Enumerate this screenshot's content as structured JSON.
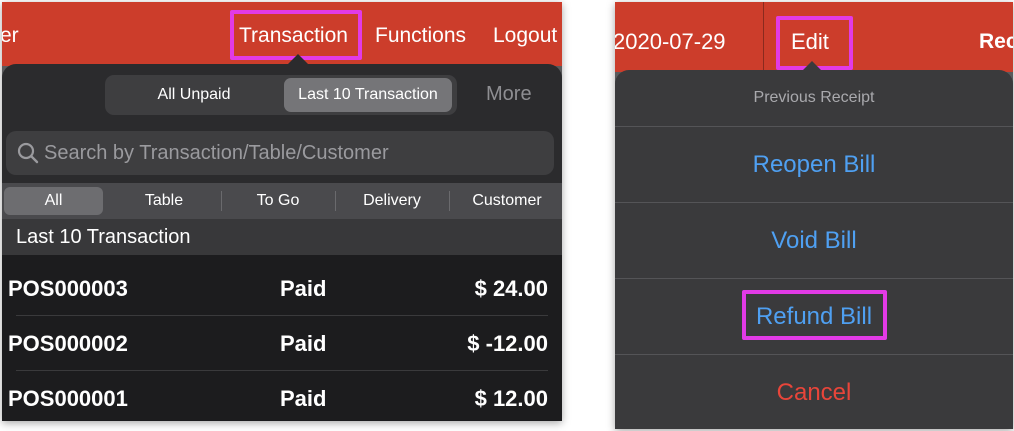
{
  "left": {
    "topbar": {
      "partial_left": "er",
      "transaction": "Transaction",
      "functions": "Functions",
      "logout": "Logout"
    },
    "segments": [
      {
        "label": "All Unpaid",
        "active": false
      },
      {
        "label": "Last 10 Transaction",
        "active": true
      }
    ],
    "more": "More",
    "search": {
      "placeholder": "Search by Transaction/Table/Customer",
      "value": ""
    },
    "filters": [
      {
        "label": "All",
        "active": true
      },
      {
        "label": "Table",
        "active": false
      },
      {
        "label": "To Go",
        "active": false
      },
      {
        "label": "Delivery",
        "active": false
      },
      {
        "label": "Customer",
        "active": false
      }
    ],
    "section_title": "Last 10 Transaction",
    "rows": [
      {
        "id": "POS000003",
        "status": "Paid",
        "amount": "$ 24.00"
      },
      {
        "id": "POS000002",
        "status": "Paid",
        "amount": "$ -12.00"
      },
      {
        "id": "POS000001",
        "status": "Paid",
        "amount": "$ 12.00"
      }
    ]
  },
  "right": {
    "topbar": {
      "date": "2020-07-29",
      "edit": "Edit",
      "partial_right": "Rec"
    },
    "menu": {
      "title": "Previous Receipt",
      "items": [
        {
          "label": "Reopen Bill",
          "color": "#4fa0f2"
        },
        {
          "label": "Void Bill",
          "color": "#4fa0f2"
        },
        {
          "label": "Refund Bill",
          "color": "#4fa0f2"
        },
        {
          "label": "Cancel",
          "color": "#e8453a"
        }
      ]
    }
  },
  "colors": {
    "header_red": "#cc3d2b",
    "highlight": "#e23ae6",
    "link_blue": "#4fa0f2",
    "destructive_red": "#e8453a"
  }
}
